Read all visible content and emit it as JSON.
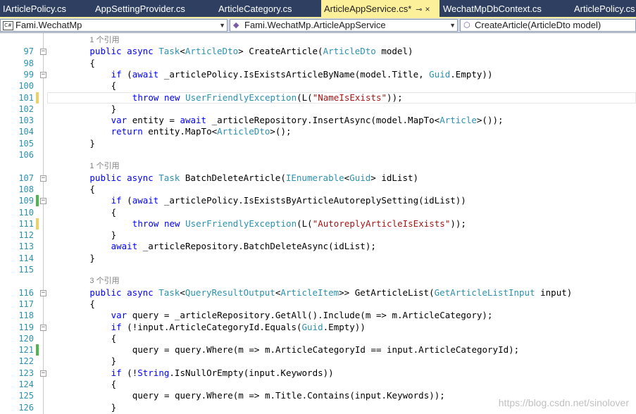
{
  "tabs": [
    {
      "label": "IArticlePolicy.cs",
      "active": false
    },
    {
      "label": "AppSettingProvider.cs",
      "active": false
    },
    {
      "label": "ArticleCategory.cs",
      "active": false
    },
    {
      "label": "ArticleAppService.cs*",
      "active": true
    },
    {
      "label": "WechatMpDbContext.cs",
      "active": false
    },
    {
      "label": "ArticlePolicy.cs",
      "active": false
    }
  ],
  "active_tab_pin": "⊸",
  "active_tab_close": "×",
  "navbar": {
    "project": "Fami.WechatMp",
    "project_icon": "C#",
    "class": "Fami.WechatMp.ArticleAppService",
    "member": "CreateArticle(ArticleDto model)",
    "dropdown_arrow": "▼"
  },
  "colors": {
    "keyword": "#0000ff",
    "type": "#2b91af",
    "string": "#a31515",
    "saved_change": "#4cb84c",
    "unsaved_change": "#f0d060",
    "tab_strip": "#2e3f61",
    "active_tab": "#fdf09b"
  },
  "editor": {
    "lines": [
      {
        "hint": "1 个引用"
      },
      {
        "n": "97",
        "fold": "−",
        "t": [
          [
            "kw",
            "public async "
          ],
          [
            "ty",
            "Task"
          ],
          [
            "",
            "<"
          ],
          [
            "ty",
            "ArticleDto"
          ],
          [
            "",
            "> CreateArticle("
          ],
          [
            "ty",
            "ArticleDto"
          ],
          [
            "",
            " model)"
          ]
        ],
        "indent": 8
      },
      {
        "n": "98",
        "t": [
          [
            "",
            "{"
          ]
        ],
        "indent": 8
      },
      {
        "n": "99",
        "fold": "−",
        "t": [
          [
            "kw",
            "if "
          ],
          [
            "",
            "("
          ],
          [
            "kw",
            "await "
          ],
          [
            "",
            "_articlePolicy.IsExistsArticleByName(model.Title, "
          ],
          [
            "ty",
            "Guid"
          ],
          [
            "",
            ".Empty))"
          ]
        ],
        "indent": 12
      },
      {
        "n": "100",
        "t": [
          [
            "",
            "{"
          ]
        ],
        "indent": 12
      },
      {
        "n": "101",
        "change": "unsaved",
        "highlight": true,
        "t": [
          [
            "kw",
            "throw new "
          ],
          [
            "ty",
            "UserFriendlyException"
          ],
          [
            "",
            "(L("
          ],
          [
            "st",
            "\"NameIsExists\""
          ],
          [
            "",
            "));"
          ]
        ],
        "indent": 16
      },
      {
        "n": "102",
        "t": [
          [
            "",
            "}"
          ]
        ],
        "indent": 12
      },
      {
        "n": "103",
        "t": [
          [
            "kw",
            "var "
          ],
          [
            "",
            "entity = "
          ],
          [
            "kw",
            "await "
          ],
          [
            "",
            "_articleRepository.InsertAsync(model.MapTo<"
          ],
          [
            "ty",
            "Article"
          ],
          [
            "",
            ">());"
          ]
        ],
        "indent": 12
      },
      {
        "n": "104",
        "t": [
          [
            "kw",
            "return "
          ],
          [
            "",
            "entity.MapTo<"
          ],
          [
            "ty",
            "ArticleDto"
          ],
          [
            "",
            ">();"
          ]
        ],
        "indent": 12
      },
      {
        "n": "105",
        "t": [
          [
            "",
            "}"
          ]
        ],
        "indent": 8
      },
      {
        "n": "106",
        "t": [],
        "indent": 0
      },
      {
        "hint": "1 个引用"
      },
      {
        "n": "107",
        "fold": "−",
        "t": [
          [
            "kw",
            "public async "
          ],
          [
            "ty",
            "Task"
          ],
          [
            "",
            " BatchDeleteArticle("
          ],
          [
            "ty",
            "IEnumerable"
          ],
          [
            "",
            "<"
          ],
          [
            "ty",
            "Guid"
          ],
          [
            "",
            "> idList)"
          ]
        ],
        "indent": 8
      },
      {
        "n": "108",
        "t": [
          [
            "",
            "{"
          ]
        ],
        "indent": 8
      },
      {
        "n": "109",
        "fold": "−",
        "change": "saved",
        "t": [
          [
            "kw",
            "if "
          ],
          [
            "",
            "("
          ],
          [
            "kw",
            "await "
          ],
          [
            "",
            "_articlePolicy.IsExistsByArticleAutoreplySetting(idList))"
          ]
        ],
        "indent": 12
      },
      {
        "n": "110",
        "t": [
          [
            "",
            "{"
          ]
        ],
        "indent": 12
      },
      {
        "n": "111",
        "change": "unsaved",
        "t": [
          [
            "kw",
            "throw new "
          ],
          [
            "ty",
            "UserFriendlyException"
          ],
          [
            "",
            "(L("
          ],
          [
            "st",
            "\"AutoreplyArticleIsExists\""
          ],
          [
            "",
            "));"
          ]
        ],
        "indent": 16
      },
      {
        "n": "112",
        "t": [
          [
            "",
            "}"
          ]
        ],
        "indent": 12
      },
      {
        "n": "113",
        "t": [
          [
            "kw",
            "await "
          ],
          [
            "",
            "_articleRepository.BatchDeleteAsync(idList);"
          ]
        ],
        "indent": 12
      },
      {
        "n": "114",
        "t": [
          [
            "",
            "}"
          ]
        ],
        "indent": 8
      },
      {
        "n": "115",
        "t": [],
        "indent": 0
      },
      {
        "hint": "3 个引用"
      },
      {
        "n": "116",
        "fold": "−",
        "t": [
          [
            "kw",
            "public async "
          ],
          [
            "ty",
            "Task"
          ],
          [
            "",
            "<"
          ],
          [
            "ty",
            "QueryResultOutput"
          ],
          [
            "",
            "<"
          ],
          [
            "ty",
            "ArticleItem"
          ],
          [
            "",
            ">> GetArticleList("
          ],
          [
            "ty",
            "GetArticleListInput"
          ],
          [
            "",
            " input)"
          ]
        ],
        "indent": 8
      },
      {
        "n": "117",
        "t": [
          [
            "",
            "{"
          ]
        ],
        "indent": 8
      },
      {
        "n": "118",
        "t": [
          [
            "kw",
            "var "
          ],
          [
            "",
            "query = _articleRepository.GetAll().Include(m => m.ArticleCategory);"
          ]
        ],
        "indent": 12
      },
      {
        "n": "119",
        "fold": "−",
        "t": [
          [
            "kw",
            "if "
          ],
          [
            "",
            "(!input.ArticleCategoryId.Equals("
          ],
          [
            "ty",
            "Guid"
          ],
          [
            "",
            ".Empty))"
          ]
        ],
        "indent": 12
      },
      {
        "n": "120",
        "t": [
          [
            "",
            "{"
          ]
        ],
        "indent": 12
      },
      {
        "n": "121",
        "change": "saved",
        "t": [
          [
            "",
            "query = query.Where(m => m.ArticleCategoryId == input.ArticleCategoryId);"
          ]
        ],
        "indent": 16
      },
      {
        "n": "122",
        "t": [
          [
            "",
            "}"
          ]
        ],
        "indent": 12
      },
      {
        "n": "123",
        "fold": "−",
        "t": [
          [
            "kw",
            "if "
          ],
          [
            "",
            "(!"
          ],
          [
            "kw",
            "String"
          ],
          [
            "",
            ".IsNullOrEmpty(input.Keywords))"
          ]
        ],
        "indent": 12
      },
      {
        "n": "124",
        "t": [
          [
            "",
            "{"
          ]
        ],
        "indent": 12
      },
      {
        "n": "125",
        "t": [
          [
            "",
            "query = query.Where(m => m.Title.Contains(input.Keywords));"
          ]
        ],
        "indent": 16
      },
      {
        "n": "126",
        "t": [
          [
            "",
            "}"
          ]
        ],
        "indent": 12
      }
    ]
  },
  "watermark": "https://blog.csdn.net/sinolover"
}
